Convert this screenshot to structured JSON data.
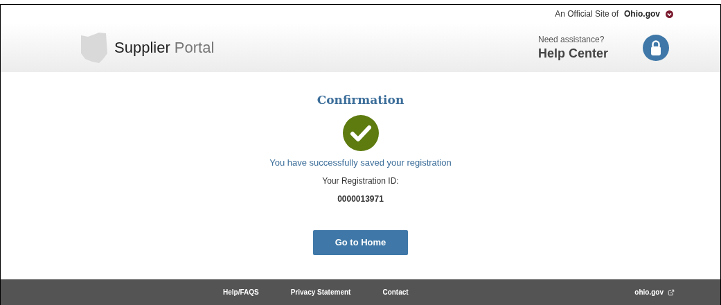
{
  "official_bar": {
    "label": "An Official Site of",
    "logo": "Ohio.gov"
  },
  "header": {
    "title": "Supplier",
    "subtitle": "Portal",
    "help_hint": "Need assistance?",
    "help_link": "Help Center"
  },
  "confirmation": {
    "title": "Confirmation",
    "message": "You have successfully saved your registration",
    "id_label": "Your Registration ID:",
    "id_value": "0000013971",
    "button": "Go to Home"
  },
  "footer": {
    "links": [
      "Help/FAQS",
      "Privacy Statement",
      "Contact"
    ],
    "external_link": "ohio.gov"
  }
}
